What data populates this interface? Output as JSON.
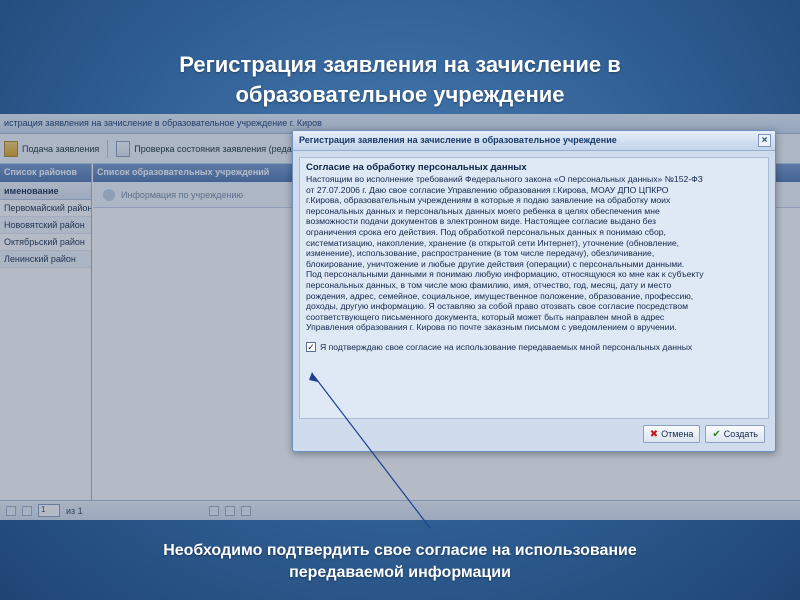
{
  "slide": {
    "title_line1": "Регистрация заявления на зачисление в",
    "title_line2": "образовательное учреждение",
    "caption_line1": "Необходимо подтвердить свое согласие на использование",
    "caption_line2": "передаваемой информации"
  },
  "app": {
    "window_title": "истрация заявления на зачисление в образовательное учреждение г. Киров",
    "toolbar": {
      "submit_label": "Подача заявления",
      "check_status_label": "Проверка состояния заявления (редакт"
    },
    "left_panel": {
      "header": "Список районов",
      "column_header": "именование",
      "items": [
        "Первомайский район",
        "Нововятский район",
        "Октябрьский район",
        "Ленинский район"
      ]
    },
    "right_panel": {
      "header": "Список образовательных учреждений",
      "ghost_item": "Информация по учреждению"
    },
    "pager": {
      "page_value": "1",
      "of_label": "из 1"
    }
  },
  "dialog": {
    "title": "Регистрация заявления на зачисление в образовательное учреждение",
    "close_glyph": "×",
    "consent_heading": "Согласие на обработку персональных данных",
    "consent_lines": [
      "Настоящим во исполнение требований Федерального закона «О персональных данных» №152-ФЗ",
      "от 27.07.2006 г. Даю свое согласие Управлению образования г.Кирова, МОАУ ДПО ЦПКРО",
      "г.Кирова, образовательным учреждениям в которые я подаю заявление на обработку моих",
      "персональных данных и персональных данных моего ребенка в целях обеспечения мне",
      "возможности подачи документов в электронном виде. Настоящее согласие выдано без",
      "ограничения срока его действия. Под обработкой персональных данных я понимаю сбор,",
      "систематизацию, накопление, хранение (в открытой сети Интернет), уточнение (обновление,",
      "изменение), использование, распространение (в том числе передачу), обезличивание,",
      "блокирование, уничтожение и любые другие действия (операции) с персональными данными.",
      "Под персональными данными я понимаю любую информацию, относящуюся ко мне как к субъекту",
      "персональных данных, в том числе мою фамилию, имя, отчество, год, месяц, дату и место",
      "рождения, адрес, семейное, социальное, имущественное положение, образование, профессию,",
      "доходы, другую информацию. Я оставляю за собой право отозвать свое согласие посредством",
      "соответствующего письменного документа, который может быть направлен мной в адрес",
      "Управления образования г. Кирова по почте заказным письмом с уведомлением о вручении."
    ],
    "confirm_checked_glyph": "✓",
    "confirm_label": "Я подтверждаю свое согласие на использование передаваемых мной персональных данных",
    "cancel_label": "Отмена",
    "create_label": "Создать"
  }
}
